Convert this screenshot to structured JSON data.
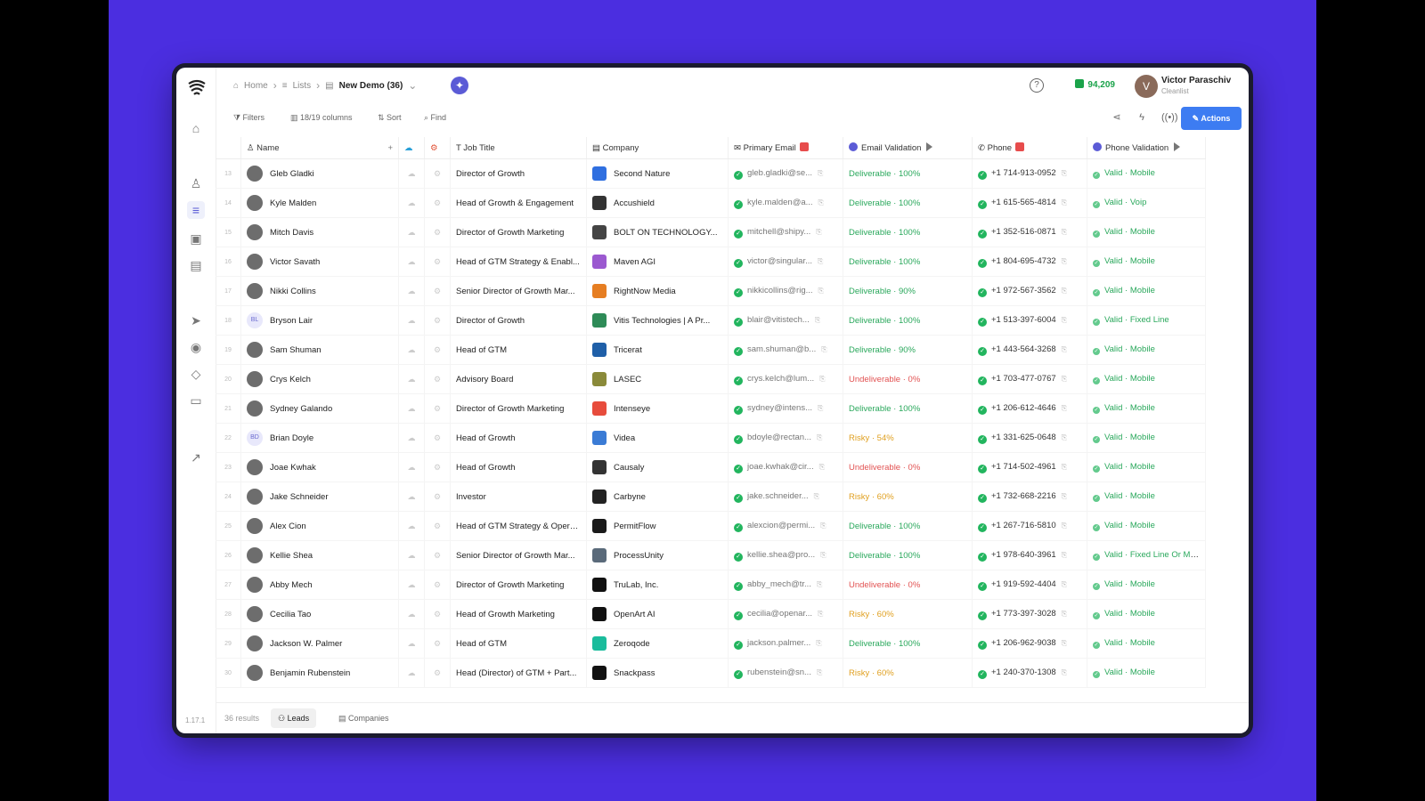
{
  "breadcrumb": {
    "home": "Home",
    "lists": "Lists",
    "current": "New Demo (36)"
  },
  "header": {
    "credits": "94,209",
    "user_name": "Victor Paraschiv",
    "user_sub": "Cleanlist",
    "avatar_initial": "V"
  },
  "toolbar": {
    "filters": "Filters",
    "columns": "18/19 columns",
    "sort": "Sort",
    "find": "Find",
    "actions": "Actions"
  },
  "columns": {
    "name": "Name",
    "job_title": "Job Title",
    "company": "Company",
    "primary_email": "Primary Email",
    "email_validation": "Email Validation",
    "phone": "Phone",
    "phone_validation": "Phone Validation"
  },
  "rows": [
    {
      "n": "13",
      "name": "Gleb Gladki",
      "title": "Director of Growth",
      "company": "Second Nature",
      "email": "gleb.gladki@se...",
      "ev": "Deliverable · 100%",
      "evs": "deliv",
      "phone": "+1 714-913-0952",
      "pv": "Valid · Mobile",
      "logo": "#2f6fe0"
    },
    {
      "n": "14",
      "name": "Kyle Malden",
      "title": "Head of Growth & Engagement",
      "company": "Accushield",
      "email": "kyle.malden@a...",
      "ev": "Deliverable · 100%",
      "evs": "deliv",
      "phone": "+1 615-565-4814",
      "pv": "Valid · Voip",
      "logo": "#333"
    },
    {
      "n": "15",
      "name": "Mitch Davis",
      "title": "Director of Growth Marketing",
      "company": "BOLT ON TECHNOLOGY...",
      "email": "mitchell@shipy...",
      "ev": "Deliverable · 100%",
      "evs": "deliv",
      "phone": "+1 352-516-0871",
      "pv": "Valid · Mobile",
      "logo": "#444"
    },
    {
      "n": "16",
      "name": "Victor Savath",
      "title": "Head of GTM Strategy & Enabl...",
      "company": "Maven AGI",
      "email": "victor@singular...",
      "ev": "Deliverable · 100%",
      "evs": "deliv",
      "phone": "+1 804-695-4732",
      "pv": "Valid · Mobile",
      "logo": "#9b59d0"
    },
    {
      "n": "17",
      "name": "Nikki Collins",
      "title": "Senior Director of Growth Mar...",
      "company": "RightNow Media",
      "email": "nikkicollins@rig...",
      "ev": "Deliverable · 90%",
      "evs": "deliv",
      "phone": "+1 972-567-3562",
      "pv": "Valid · Mobile",
      "logo": "#e67e22"
    },
    {
      "n": "18",
      "name": "Bryson Lair",
      "title": "Director of Growth",
      "company": "Vitis Technologies | A Pr...",
      "email": "blair@vitistech...",
      "ev": "Deliverable · 100%",
      "evs": "deliv",
      "phone": "+1 513-397-6004",
      "pv": "Valid · Fixed Line",
      "logo": "#2e8b57",
      "initials": "BL"
    },
    {
      "n": "19",
      "name": "Sam Shuman",
      "title": "Head of GTM",
      "company": "Tricerat",
      "email": "sam.shuman@b...",
      "ev": "Deliverable · 90%",
      "evs": "deliv",
      "phone": "+1 443-564-3268",
      "pv": "Valid · Mobile",
      "logo": "#1f5fa8"
    },
    {
      "n": "20",
      "name": "Crys Kelch",
      "title": "Advisory Board",
      "company": "LASEC",
      "email": "crys.kelch@lum...",
      "ev": "Undeliverable · 0%",
      "evs": "undel",
      "phone": "+1 703-477-0767",
      "pv": "Valid · Mobile",
      "logo": "#8a8a3a"
    },
    {
      "n": "21",
      "name": "Sydney Galando",
      "title": "Director of Growth Marketing",
      "company": "Intenseye",
      "email": "sydney@intens...",
      "ev": "Deliverable · 100%",
      "evs": "deliv",
      "phone": "+1 206-612-4646",
      "pv": "Valid · Mobile",
      "logo": "#e74c3c"
    },
    {
      "n": "22",
      "name": "Brian Doyle",
      "title": "Head of Growth",
      "company": "Videa",
      "email": "bdoyle@rectan...",
      "ev": "Risky · 54%",
      "evs": "risky",
      "phone": "+1 331-625-0648",
      "pv": "Valid · Mobile",
      "logo": "#3a7bd5",
      "initials": "BD"
    },
    {
      "n": "23",
      "name": "Joae Kwhak",
      "title": "Head of Growth",
      "company": "Causaly",
      "email": "joae.kwhak@cir...",
      "ev": "Undeliverable · 0%",
      "evs": "undel",
      "phone": "+1 714-502-4961",
      "pv": "Valid · Mobile",
      "logo": "#333"
    },
    {
      "n": "24",
      "name": "Jake Schneider",
      "title": "Investor",
      "company": "Carbyne",
      "email": "jake.schneider...",
      "ev": "Risky · 60%",
      "evs": "risky",
      "phone": "+1 732-668-2216",
      "pv": "Valid · Mobile",
      "logo": "#222"
    },
    {
      "n": "25",
      "name": "Alex Cion",
      "title": "Head of GTM Strategy & Opera...",
      "company": "PermitFlow",
      "email": "alexcion@permi...",
      "ev": "Deliverable · 100%",
      "evs": "deliv",
      "phone": "+1 267-716-5810",
      "pv": "Valid · Mobile",
      "logo": "#1a1a1a"
    },
    {
      "n": "26",
      "name": "Kellie Shea",
      "title": "Senior Director of Growth Mar...",
      "company": "ProcessUnity",
      "email": "kellie.shea@pro...",
      "ev": "Deliverable · 100%",
      "evs": "deliv",
      "phone": "+1 978-640-3961",
      "pv": "Valid · Fixed Line Or Mo...",
      "logo": "#5a6a7a"
    },
    {
      "n": "27",
      "name": "Abby Mech",
      "title": "Director of Growth Marketing",
      "company": "TruLab, Inc.",
      "email": "abby_mech@tr...",
      "ev": "Undeliverable · 0%",
      "evs": "undel",
      "phone": "+1 919-592-4404",
      "pv": "Valid · Mobile",
      "logo": "#111"
    },
    {
      "n": "28",
      "name": "Cecilia Tao",
      "title": "Head of Growth Marketing",
      "company": "OpenArt AI",
      "email": "cecilia@openar...",
      "ev": "Risky · 60%",
      "evs": "risky",
      "phone": "+1 773-397-3028",
      "pv": "Valid · Mobile",
      "logo": "#111"
    },
    {
      "n": "29",
      "name": "Jackson W. Palmer",
      "title": "Head of GTM",
      "company": "Zeroqode",
      "email": "jackson.palmer...",
      "ev": "Deliverable · 100%",
      "evs": "deliv",
      "phone": "+1 206-962-9038",
      "pv": "Valid · Mobile",
      "logo": "#1abc9c"
    },
    {
      "n": "30",
      "name": "Benjamin Rubenstein",
      "title": "Head (Director) of GTM + Part...",
      "company": "Snackpass",
      "email": "rubenstein@sn...",
      "ev": "Risky · 60%",
      "evs": "risky",
      "phone": "+1 240-370-1308",
      "pv": "Valid · Mobile",
      "logo": "#111"
    }
  ],
  "footer": {
    "count": "36 results",
    "tab_leads": "Leads",
    "tab_companies": "Companies"
  },
  "version": "1.17.1",
  "icons": {
    "home": "home-icon",
    "help": "help-icon",
    "share": "share-icon",
    "bolt": "bolt-icon",
    "broadcast": "broadcast-icon"
  }
}
